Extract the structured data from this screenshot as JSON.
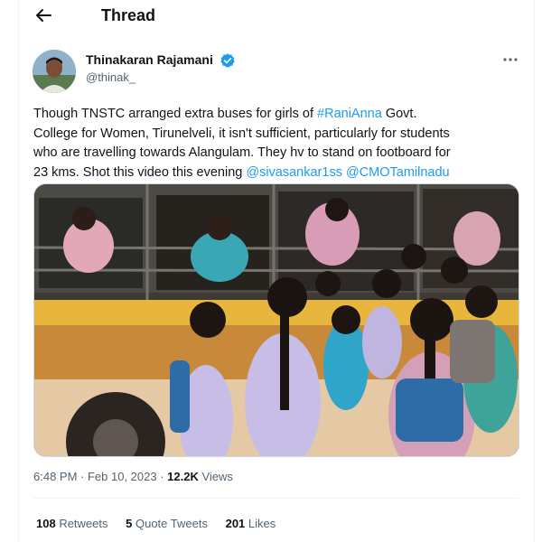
{
  "header": {
    "title": "Thread"
  },
  "author": {
    "name": "Thinakaran Rajamani",
    "handle": "@thinak_"
  },
  "tweet": {
    "line1_pre": "Though TNSTC arranged extra buses for girls of ",
    "line1_hashtag": "#RaniAnna",
    "line1_post": " Govt.",
    "line2": "College for Women, Tirunelveli, it isn't sufficient, particularly for students",
    "line3": "who are travelling towards Alangulam. They hv to stand on footboard for",
    "line4_pre": "23 kms. Shot this video this evening ",
    "mention1": "@sivasankar1ss",
    "mention2": "@CMOTamilnadu"
  },
  "meta": {
    "time": "6:48 PM · Feb 10, 2023",
    "sep": " · ",
    "views_count": "12.2K",
    "views_label": " Views"
  },
  "stats": {
    "retweets_count": "108",
    "retweets_label": " Retweets",
    "quotes_count": "5",
    "quotes_label": " Quote Tweets",
    "likes_count": "201",
    "likes_label": " Likes"
  },
  "colors": {
    "link": "#1d9bf0",
    "verified": "#1d9bf0",
    "bus_yellow": "#e9b63d",
    "uniform_lilac": "#c7bde6"
  },
  "icons": [
    "back-arrow-icon",
    "verified-badge-icon",
    "more-options-icon"
  ]
}
